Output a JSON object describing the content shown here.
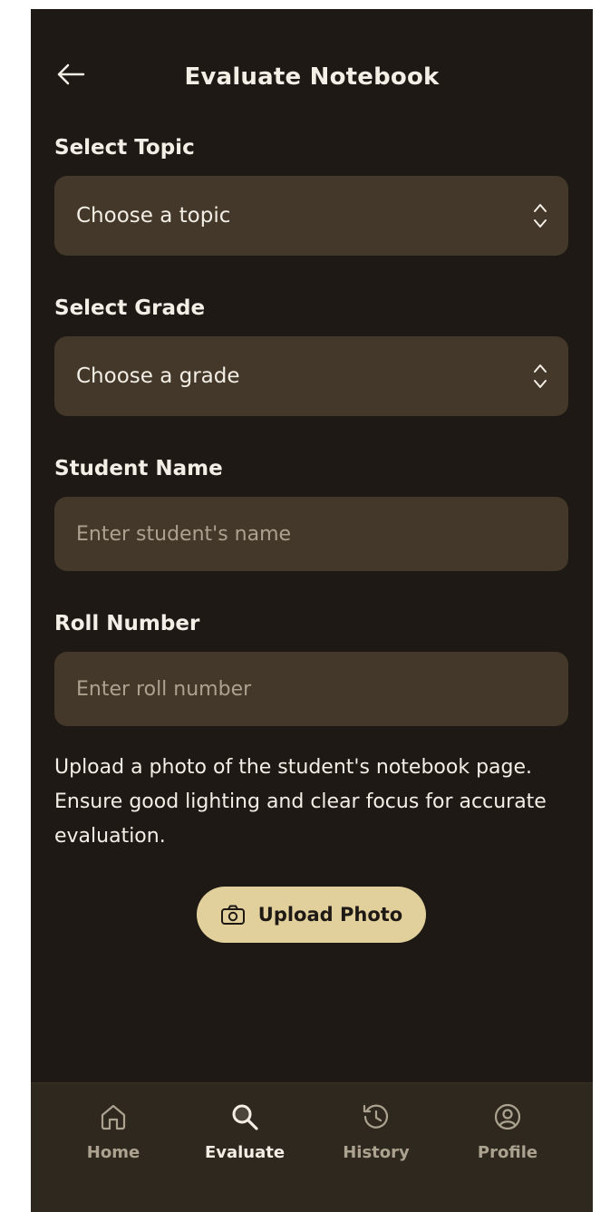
{
  "header": {
    "title": "Evaluate Notebook"
  },
  "form": {
    "topic": {
      "label": "Select Topic",
      "value": "Choose a topic"
    },
    "grade": {
      "label": "Select Grade",
      "value": "Choose a grade"
    },
    "student_name": {
      "label": "Student Name",
      "placeholder": "Enter student's name"
    },
    "roll_number": {
      "label": "Roll Number",
      "placeholder": "Enter roll number"
    }
  },
  "help_text": "Upload a photo of the student's notebook page. Ensure good lighting and clear focus for accurate evaluation.",
  "upload": {
    "label": "Upload Photo",
    "icon": "camera-icon"
  },
  "nav": {
    "items": [
      {
        "label": "Home",
        "icon": "home-icon",
        "active": false
      },
      {
        "label": "Evaluate",
        "icon": "search-icon",
        "active": true
      },
      {
        "label": "History",
        "icon": "history-icon",
        "active": false
      },
      {
        "label": "Profile",
        "icon": "profile-icon",
        "active": false
      }
    ]
  },
  "colors": {
    "background": "#1e1914",
    "field": "#433829",
    "accent": "#e2d09c",
    "text": "#f3eee6",
    "muted": "#aca290",
    "tabbar": "#2f281e"
  }
}
